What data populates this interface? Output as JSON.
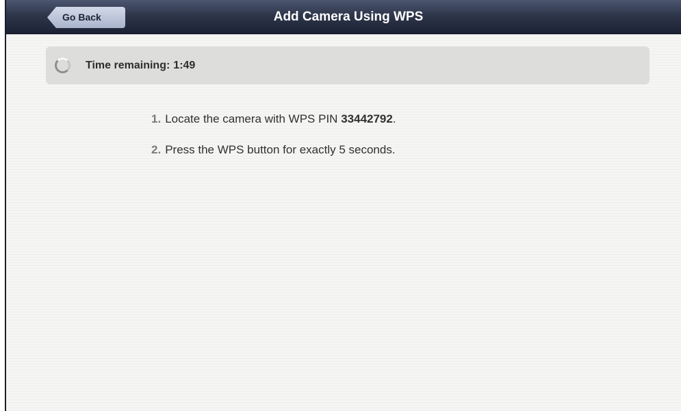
{
  "header": {
    "back_label": "Go Back",
    "title": "Add Camera Using WPS"
  },
  "timer": {
    "label": "Time remaining:",
    "value": "1:49",
    "icon": "spinner-icon"
  },
  "steps": [
    {
      "number": "1.",
      "text_before": "Locate the camera with WPS PIN",
      "pin": "33442792",
      "text_after": "."
    },
    {
      "number": "2.",
      "text": "Press the WPS button for exactly 5 seconds."
    }
  ],
  "colors": {
    "header_dark": "#1c2234",
    "header_light": "#4c5670",
    "back_button": "#b9c3d8",
    "timer_box": "#dddddb",
    "background": "#f3f3f2"
  }
}
